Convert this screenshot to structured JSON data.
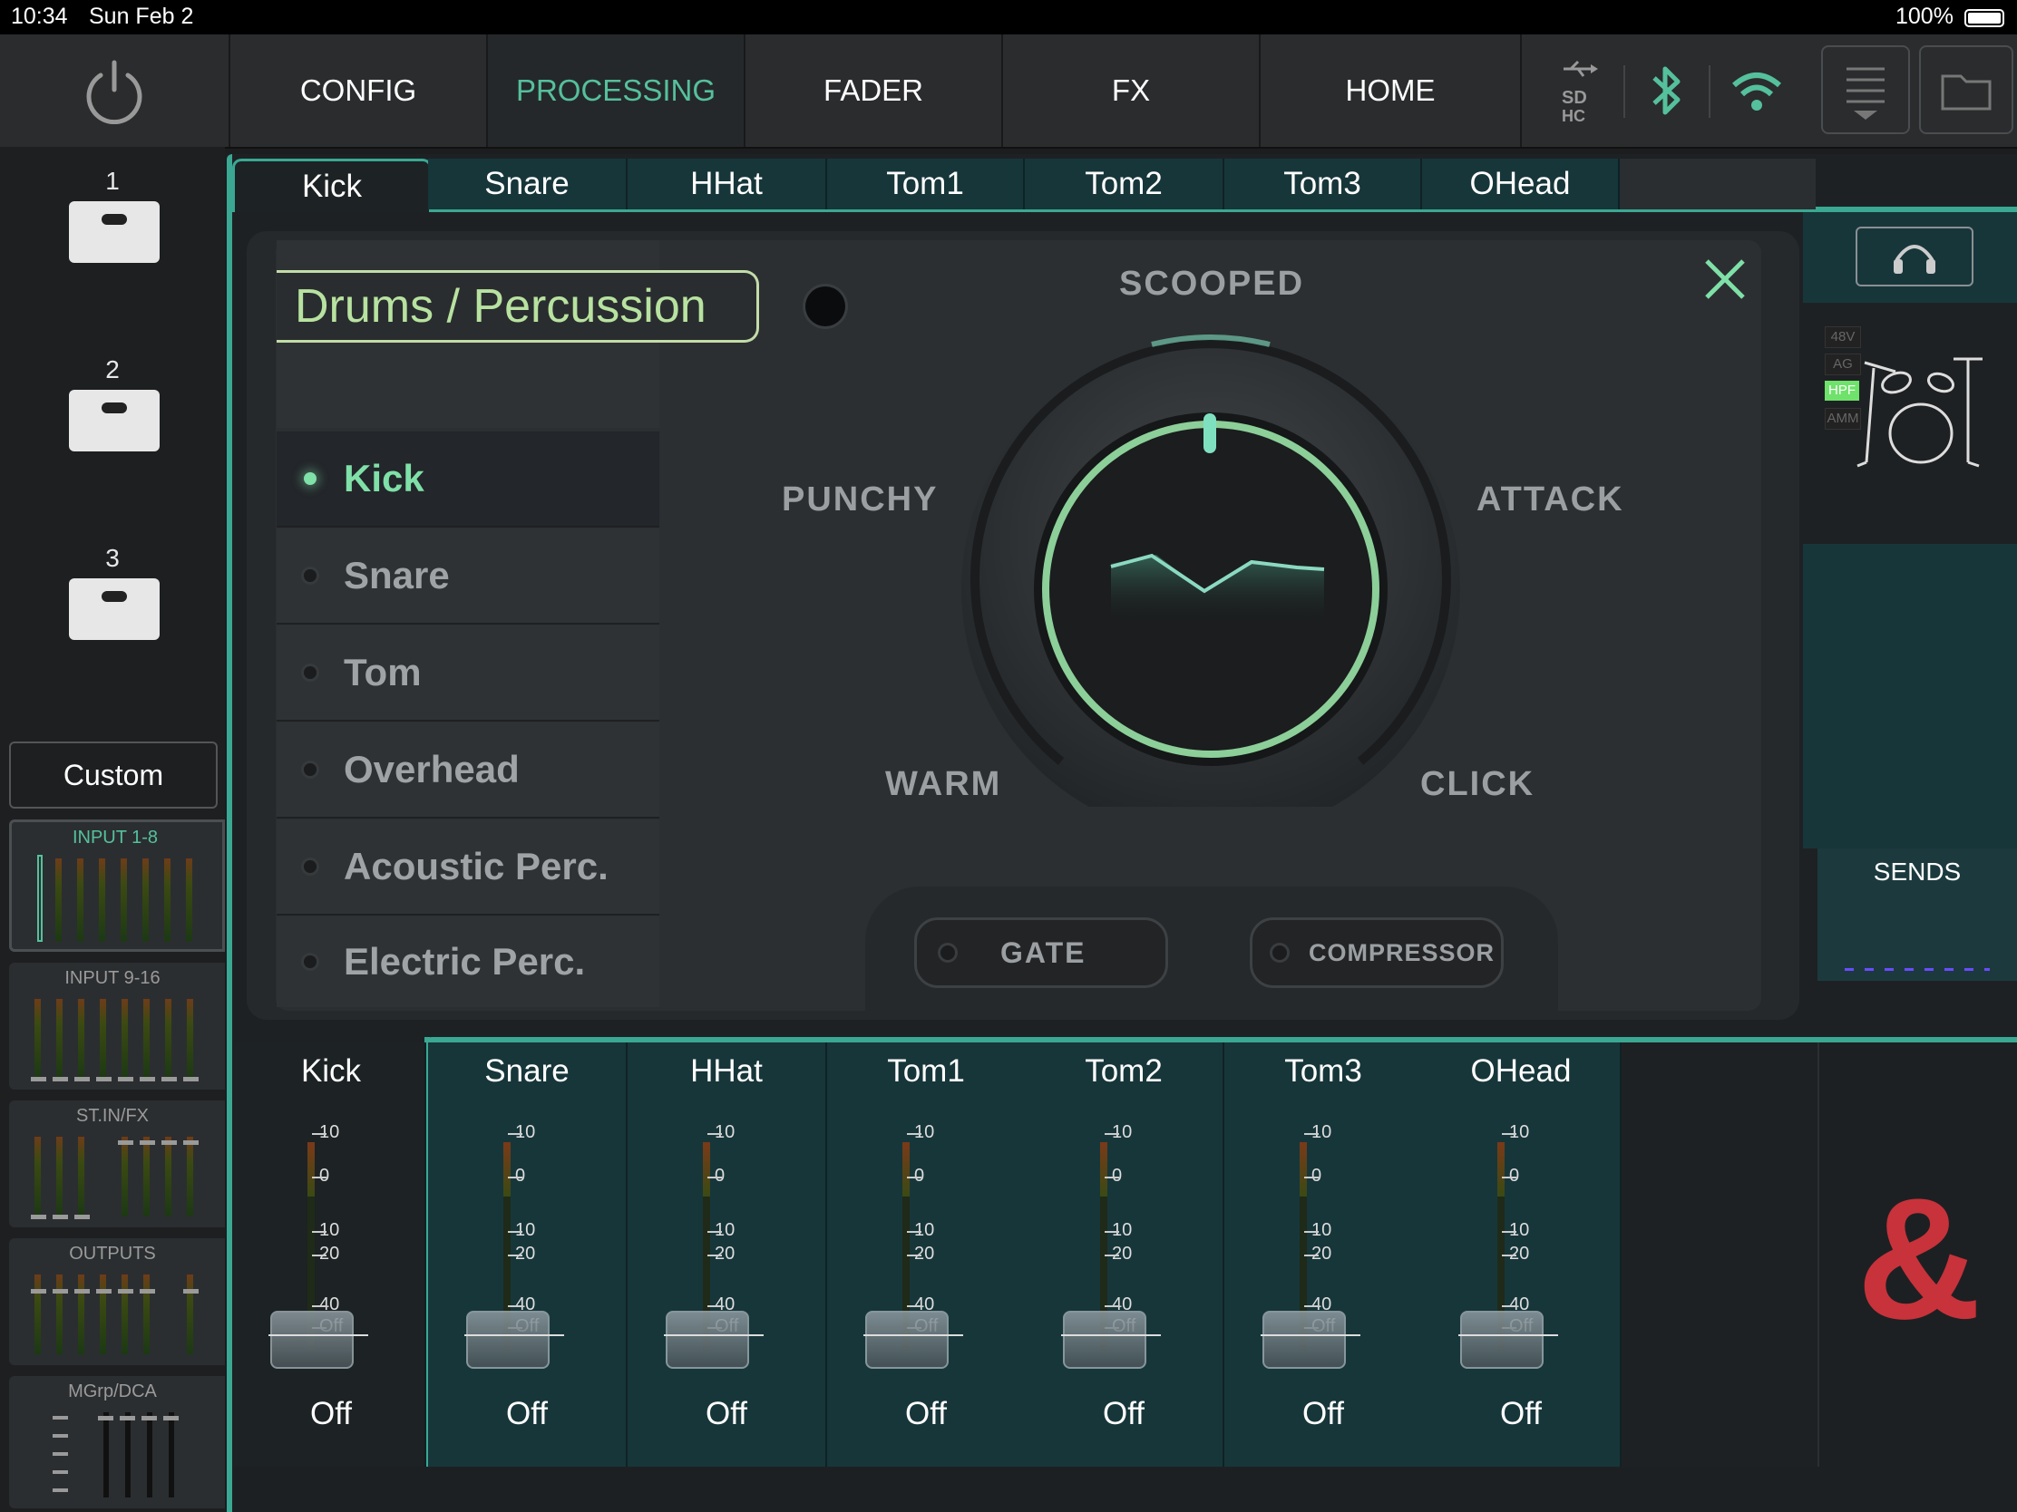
{
  "status_bar": {
    "time": "10:34",
    "date": "Sun Feb 2",
    "battery": "100%"
  },
  "nav": {
    "power_icon": "power-icon",
    "tabs": [
      {
        "label": "CONFIG"
      },
      {
        "label": "PROCESSING",
        "active": true
      },
      {
        "label": "FADER"
      },
      {
        "label": "FX"
      },
      {
        "label": "HOME"
      }
    ],
    "icons": [
      "usb-sd-icon",
      "bluetooth-icon",
      "wifi-icon",
      "menu-icon",
      "folder-icon"
    ],
    "accent": "#55c09c"
  },
  "sidebar": {
    "scenes": [
      {
        "num": "1"
      },
      {
        "num": "2"
      },
      {
        "num": "3"
      }
    ],
    "custom_label": "Custom",
    "banks": [
      {
        "label": "INPUT 1-8",
        "selected": true
      },
      {
        "label": "INPUT 9-16"
      },
      {
        "label": "ST.IN/FX"
      },
      {
        "label": "OUTPUTS"
      },
      {
        "label": "MGrp/DCA"
      }
    ]
  },
  "channel_tabs": [
    "Kick",
    "Snare",
    "HHat",
    "Tom1",
    "Tom2",
    "Tom3",
    "OHead"
  ],
  "popup": {
    "category": "Drums / Percussion",
    "instruments": [
      {
        "label": "Kick",
        "selected": true
      },
      {
        "label": "Snare"
      },
      {
        "label": "Tom"
      },
      {
        "label": "Overhead"
      },
      {
        "label": "Acoustic Perc."
      },
      {
        "label": "Electric Perc."
      }
    ],
    "dial_labels": {
      "top": "SCOOPED",
      "left": "PUNCHY",
      "right": "ATTACK",
      "bottom_left": "WARM",
      "bottom_right": "CLICK"
    },
    "gate_label": "GATE",
    "compressor_label": "COMPRESSOR",
    "close_icon": "close-icon",
    "accent": "#7fe0a8"
  },
  "right_panel": {
    "headphones_icon": "headphones-icon",
    "badges": [
      "48V",
      "AG",
      "HPF",
      "AMM"
    ],
    "drumkit_icon": "drumkit-icon",
    "sends_label": "SENDS",
    "logo": "&",
    "logo_color": "#c8323a"
  },
  "mixer": {
    "channels": [
      {
        "name": "Kick",
        "value": "Off"
      },
      {
        "name": "Snare",
        "value": "Off"
      },
      {
        "name": "HHat",
        "value": "Off"
      },
      {
        "name": "Tom1",
        "value": "Off"
      },
      {
        "name": "Tom2",
        "value": "Off"
      },
      {
        "name": "Tom3",
        "value": "Off"
      },
      {
        "name": "OHead",
        "value": "Off"
      }
    ],
    "scale": [
      "10",
      "0",
      "10",
      "20",
      "40",
      "Off"
    ]
  }
}
